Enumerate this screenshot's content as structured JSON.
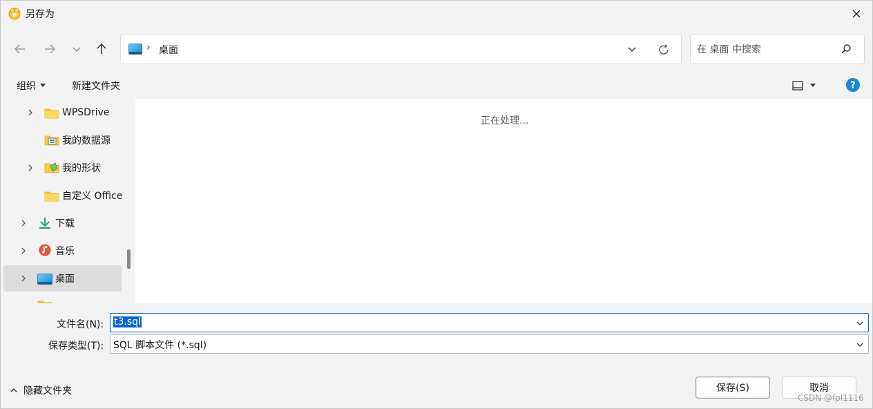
{
  "title": "另存为",
  "nav": {
    "address_segment": "桌面",
    "search_placeholder": "在 桌面 中搜索"
  },
  "toolbar": {
    "organize_label": "组织",
    "new_folder_label": "新建文件夹"
  },
  "tree": {
    "items": [
      {
        "label": "WPSDrive",
        "icon": "folder-icon"
      },
      {
        "label": "我的数据源",
        "icon": "data-source-icon"
      },
      {
        "label": "我的形状",
        "icon": "shapes-icon"
      },
      {
        "label": "自定义 Office",
        "icon": "folder-icon"
      },
      {
        "label": "下载",
        "icon": "download-icon"
      },
      {
        "label": "音乐",
        "icon": "music-icon"
      },
      {
        "label": "桌面",
        "icon": "desktop-icon"
      }
    ]
  },
  "content": {
    "status": "正在处理..."
  },
  "fields": {
    "filename_label": "文件名(N):",
    "filename_value": "t3.sql",
    "filetype_label": "保存类型(T):",
    "filetype_value": "SQL 脚本文件 (*.sql)"
  },
  "footer": {
    "hide_folders_label": "隐藏文件夹",
    "save_label": "保存(S)",
    "cancel_label": "取消",
    "watermark": "CSDN @fpl1116"
  },
  "colors": {
    "accent": "#0067c0",
    "selection": "#0a64d2",
    "help": "#1a86d9"
  }
}
